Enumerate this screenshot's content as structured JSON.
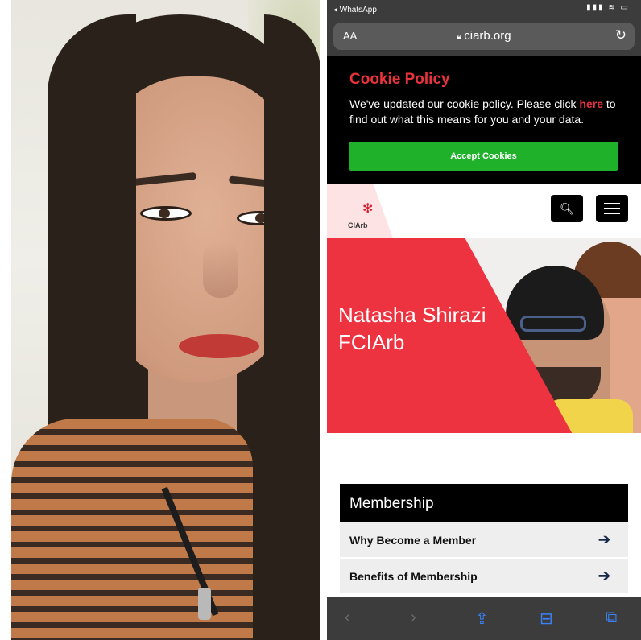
{
  "statusbar": {
    "back_app": "◂ WhatsApp",
    "status_icons": "▮▮▮ ≋ ▭"
  },
  "browser": {
    "text_size": "AA",
    "lock_icon": "lock-icon",
    "url": "ciarb.org",
    "reload_icon": "↻"
  },
  "cookie_banner": {
    "title": "Cookie Policy",
    "message_before": "We've updated our cookie policy. Please click ",
    "link_text": "here",
    "message_after": " to find out what this means for you and your data.",
    "accept_label": "Accept Cookies",
    "accent_color": "#e8323c",
    "button_color": "#1fb12a"
  },
  "site_header": {
    "logo_text": "CIArb",
    "search_icon": "search-icon",
    "menu_icon": "hamburger-menu-icon"
  },
  "hero": {
    "name": "Natasha Shirazi FCIArb",
    "brand_color": "#ee3340"
  },
  "membership": {
    "heading": "Membership",
    "items": [
      {
        "label": "Why Become a Member",
        "icon": "arrow-right-icon"
      },
      {
        "label": "Benefits of Membership",
        "icon": "arrow-right-icon"
      }
    ]
  },
  "toolbar": {
    "back": "‹",
    "forward": "›",
    "share": "⇪",
    "bookmarks": "⊟",
    "tabs": "⧉"
  }
}
